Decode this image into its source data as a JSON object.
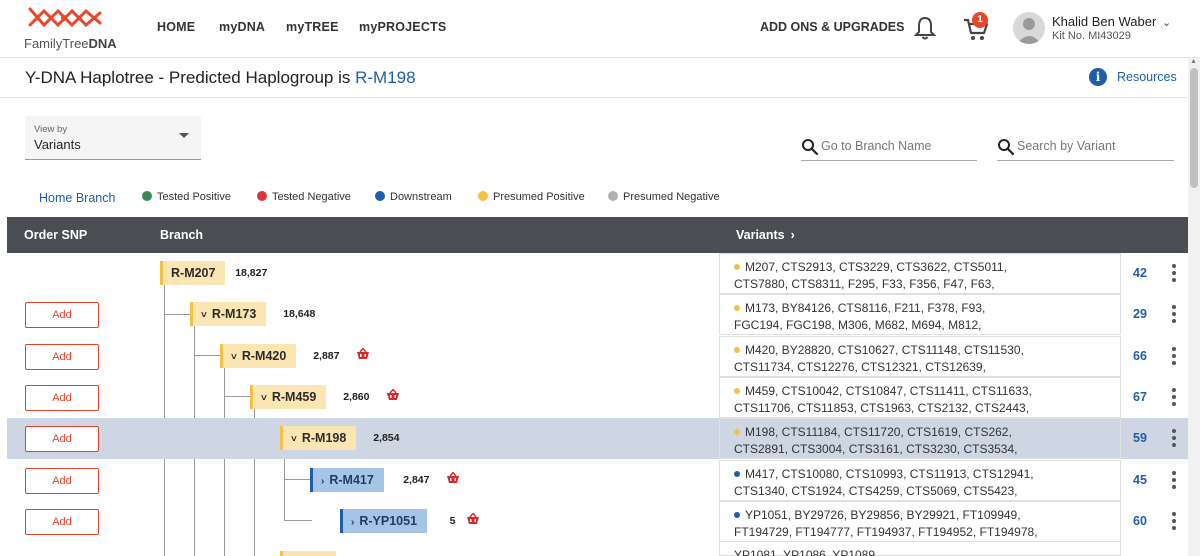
{
  "header": {
    "logo_text_plain": "FamilyTree",
    "logo_text_bold": "DNA",
    "nav": [
      "HOME",
      "myDNA",
      "myTREE",
      "myPROJECTS"
    ],
    "addons": "ADD ONS & UPGRADES",
    "cart_count": "1",
    "user_name": "Khalid Ben Waber",
    "kit_no": "Kit No. MI43029"
  },
  "title": {
    "prefix": "Y-DNA Haplotree - Predicted Haplogroup is ",
    "haplogroup": "R-M198",
    "resources": "Resources"
  },
  "controls": {
    "viewby_label": "View by",
    "viewby_value": "Variants",
    "branch_search_placeholder": "Go to Branch Name",
    "variant_search_placeholder": "Search by Variant"
  },
  "legend": {
    "home_branch": "Home Branch",
    "items": [
      {
        "label": "Tested Positive",
        "color": "#3a8a4f"
      },
      {
        "label": "Tested Negative",
        "color": "#e0353b"
      },
      {
        "label": "Downstream",
        "color": "#1f5ea8"
      },
      {
        "label": "Presumed Positive",
        "color": "#f5c142"
      },
      {
        "label": "Presumed Negative",
        "color": "#b0b0b0"
      }
    ]
  },
  "table": {
    "col_order": "Order SNP",
    "col_branch": "Branch",
    "col_variants": "Variants",
    "add_label": "Add",
    "rows": [
      {
        "branch": "R-M207",
        "count": "18,827",
        "style": "yellow",
        "chev": "",
        "has_add": false,
        "basket": false,
        "selected": false,
        "dot": "#f5c142",
        "line1": "M207,  CTS2913,  CTS3229,  CTS3622,  CTS5011,",
        "line2": "CTS7880,  CTS8311,  F295,  F33,  F356,  F47,  F63,",
        "total": "42"
      },
      {
        "branch": "R-M173",
        "count": "18,648",
        "style": "yellow",
        "chev": "˅",
        "has_add": true,
        "basket": false,
        "selected": false,
        "dot": "#f5c142",
        "line1": "M173,  BY84126,  CTS8116,  F211,  F378,  F93,",
        "line2": "FGC194,  FGC198,  M306,  M682,  M694,  M812,",
        "total": "29"
      },
      {
        "branch": "R-M420",
        "count": "2,887",
        "style": "yellow",
        "chev": "˅",
        "has_add": true,
        "basket": true,
        "selected": false,
        "dot": "#f5c142",
        "line1": "M420,  BY28820,  CTS10627,  CTS11148,  CTS11530,",
        "line2": "CTS11734,  CTS12276,  CTS12321,  CTS12639,",
        "total": "66"
      },
      {
        "branch": "R-M459",
        "count": "2,860",
        "style": "yellow",
        "chev": "˅",
        "has_add": true,
        "basket": true,
        "selected": false,
        "dot": "#f5c142",
        "line1": "M459,  CTS10042,  CTS10847,  CTS11411,  CTS11633,",
        "line2": "CTS11706,  CTS11853,  CTS1963,  CTS2132,  CTS2443,",
        "total": "67"
      },
      {
        "branch": "R-M198",
        "count": "2,854",
        "style": "yellow",
        "chev": "˅",
        "has_add": true,
        "basket": false,
        "selected": true,
        "dot": "#f5c142",
        "line1": "M198,  CTS11184,  CTS11720,  CTS1619,  CTS262,",
        "line2": "CTS2891,  CTS3004,  CTS3161,  CTS3230,  CTS3534,",
        "total": "59"
      },
      {
        "branch": "R-M417",
        "count": "2,847",
        "style": "blue",
        "chev": "›",
        "has_add": true,
        "basket": true,
        "selected": false,
        "dot": "#1f5ea8",
        "line1": "M417,  CTS10080,  CTS10993,  CTS11913,  CTS12941,",
        "line2": "CTS1340,  CTS1924,  CTS4259,  CTS5069,  CTS5423,",
        "total": "45"
      },
      {
        "branch": "R-YP1051",
        "count": "5",
        "style": "blue",
        "chev": "›",
        "has_add": true,
        "basket": true,
        "selected": false,
        "dot": "#1f5ea8",
        "line1": "YP1051,  BY29726,  BY29856,  BY29921,  FT109949,",
        "line2": "FT194729,  FT194777,  FT194937,  FT194952,  FT194978,",
        "total": "60"
      }
    ],
    "partial_row": {
      "line1": "YP1081,  YP1086,  YP1089,"
    }
  }
}
